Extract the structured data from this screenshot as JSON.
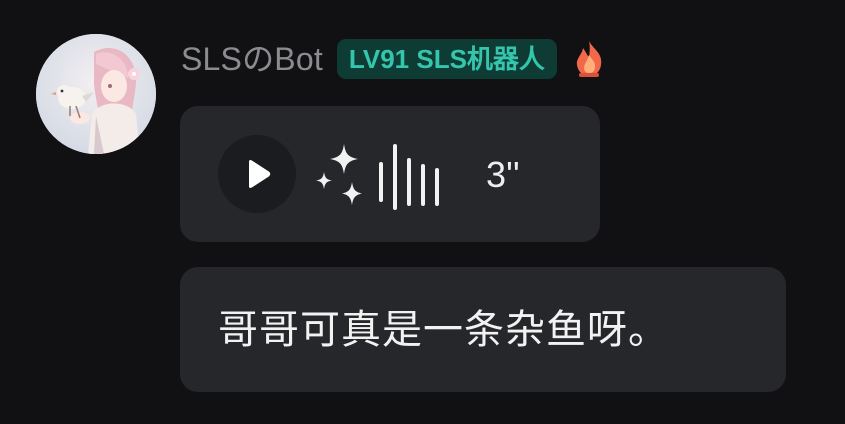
{
  "message": {
    "sender_name": "SLSのBot",
    "level_badge": "LV91 SLS机器人",
    "badge_colors": {
      "background": "#0f3b35",
      "text": "#34c6ad"
    },
    "title_icon": "fire-icon",
    "avatar": "anime-girl-with-bird-avatar",
    "voice": {
      "play_icon": "play-icon",
      "effect_icon": "sparkle-icon",
      "waveform_icon": "waveform-icon",
      "duration": "3''"
    },
    "text": "哥哥可真是一条杂鱼呀。"
  }
}
